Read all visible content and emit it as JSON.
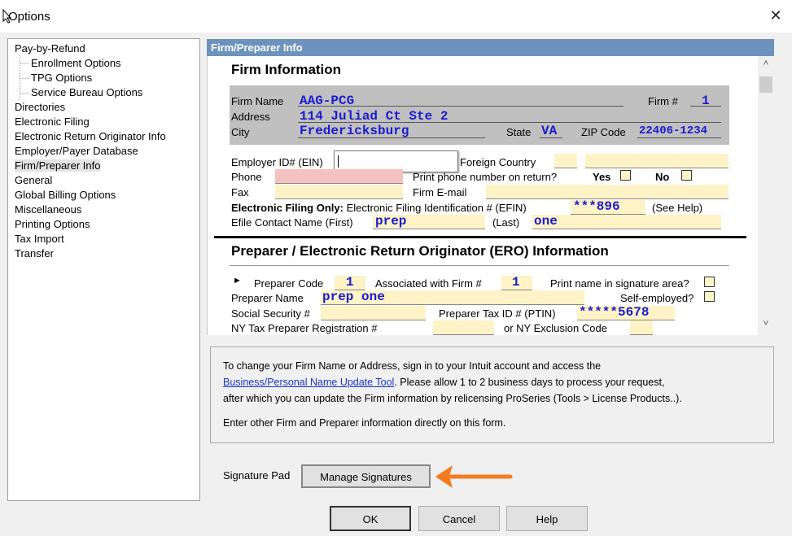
{
  "window": {
    "title": "Options",
    "close_glyph": "✕"
  },
  "sidebar": {
    "items": [
      {
        "label": "Pay-by-Refund"
      },
      {
        "label": "Enrollment Options"
      },
      {
        "label": "TPG Options"
      },
      {
        "label": "Service Bureau Options"
      },
      {
        "label": "Directories"
      },
      {
        "label": "Electronic Filing"
      },
      {
        "label": "Electronic Return Originator Info"
      },
      {
        "label": "Employer/Payer Database"
      },
      {
        "label": "Firm/Preparer Info"
      },
      {
        "label": "General"
      },
      {
        "label": "Global Billing Options"
      },
      {
        "label": "Miscellaneous"
      },
      {
        "label": "Printing Options"
      },
      {
        "label": "Tax Import"
      },
      {
        "label": "Transfer"
      }
    ],
    "selected": "Firm/Preparer Info"
  },
  "panel": {
    "header": "Firm/Preparer Info",
    "firm": {
      "heading": "Firm Information",
      "firm_name_label": "Firm Name",
      "firm_name": "AAG-PCG",
      "firm_num_label": "Firm #",
      "firm_num": "1",
      "address_label": "Address",
      "address": "114 Juliad Ct Ste 2",
      "city_label": "City",
      "city": "Fredericksburg",
      "state_label": "State",
      "state": "VA",
      "zip_label": "ZIP Code",
      "zip": "22406-1234",
      "ein_label": "Employer ID# (EIN)",
      "ein": "",
      "foreign_label": "Foreign Country",
      "phone_label": "Phone",
      "print_phone_label": "Print phone number on return?",
      "yes_label": "Yes",
      "no_label": "No",
      "fax_label": "Fax",
      "email_label": "Firm E-mail",
      "efin_bold": "Electronic Filing Only:",
      "efin_label": "Electronic Filing Identification # (EFIN)",
      "efin": "***896",
      "see_help": "(See Help)",
      "contact_first_label": "Efile Contact Name (First)",
      "contact_first": "prep",
      "contact_last_label": "(Last)",
      "contact_last": "one"
    },
    "preparer": {
      "heading": "Preparer / Electronic Return Originator (ERO) Information",
      "pointer": "►",
      "code_label": "Preparer Code",
      "code": "1",
      "assoc_label": "Associated with Firm #",
      "assoc": "1",
      "print_name_label": "Print name in signature area?",
      "self_employed_label": "Self-employed?",
      "name_label": "Preparer Name",
      "name": "prep one",
      "ssn_label": "Social Security #",
      "ptin_label": "Preparer Tax ID # (PTIN)",
      "ptin": "*****5678",
      "ny_label": "NY Tax Preparer Registration #",
      "ny_excl_label": "or NY Exclusion Code"
    }
  },
  "info": {
    "line1": "To change your Firm Name or Address, sign in to your Intuit account and access the",
    "link": "Business/Personal Name Update Tool",
    "line2_rest": ". Please allow 1 to 2 business days to process your request,",
    "line3": "after which you can update the Firm information by relicensing ProSeries (Tools > License Products..).",
    "line4": "Enter other Firm and Preparer information directly on this form."
  },
  "signature": {
    "label": "Signature Pad",
    "button": "Manage Signatures"
  },
  "buttons": {
    "ok": "OK",
    "cancel": "Cancel",
    "help": "Help"
  },
  "colors": {
    "header_blue": "#6d93bd",
    "value_blue": "#1a1ad0",
    "field_yellow": "#fdf3c6",
    "phone_pink": "#f4c2c2",
    "arrow_orange": "#f47b20"
  }
}
